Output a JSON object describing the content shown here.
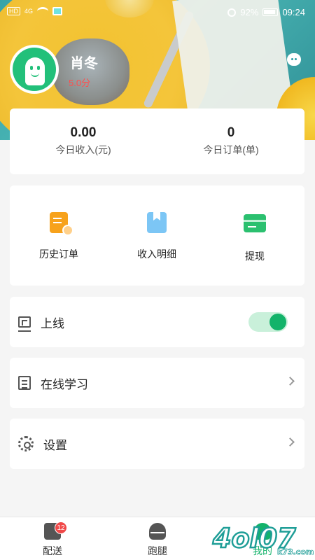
{
  "status_bar": {
    "network_chip": "HD",
    "signal_label": "4G",
    "battery_percent": "92%",
    "time": "09:24"
  },
  "profile": {
    "name": "肖冬",
    "level": "5.0分"
  },
  "stats": [
    {
      "value": "0.00",
      "label": "今日收入(元)"
    },
    {
      "value": "0",
      "label": "今日订单(单)"
    }
  ],
  "quick_actions": [
    {
      "label": "历史订单",
      "icon": "history-orders-icon"
    },
    {
      "label": "收入明细",
      "icon": "income-details-icon"
    },
    {
      "label": "提现",
      "icon": "withdraw-icon"
    }
  ],
  "menu": {
    "online": {
      "label": "上线",
      "toggle_on": true
    },
    "study": {
      "label": "在线学习"
    },
    "settings": {
      "label": "设置"
    }
  },
  "tabs": [
    {
      "label": "配送",
      "badge": "12",
      "active": false
    },
    {
      "label": "跑腿",
      "active": false
    },
    {
      "label": "我的",
      "active": true
    }
  ],
  "watermark": "k73.com",
  "colors": {
    "accent": "#13b36a",
    "badge": "#f04848",
    "level_text": "#ff4d4d"
  }
}
